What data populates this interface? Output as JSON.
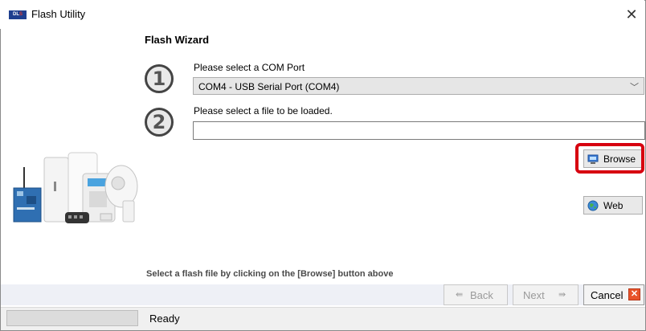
{
  "window": {
    "title": "Flash Utility",
    "app_icon_text": "DLS"
  },
  "wizard": {
    "heading": "Flash Wizard",
    "step1": {
      "number": "1",
      "label": "Please select a COM Port",
      "selected": "COM4 - USB Serial Port (COM4)"
    },
    "step2": {
      "number": "2",
      "label": "Please select a file to be loaded.",
      "file_value": ""
    },
    "browse_label": "Browse",
    "web_label": "Web",
    "hint": "Select a flash file by clicking on the [Browse] button above"
  },
  "nav": {
    "back_label": "Back",
    "next_label": "Next",
    "cancel_label": "Cancel"
  },
  "status": {
    "text": "Ready"
  },
  "colors": {
    "highlight": "#d7000f",
    "cancel_icon": "#e8532a"
  }
}
